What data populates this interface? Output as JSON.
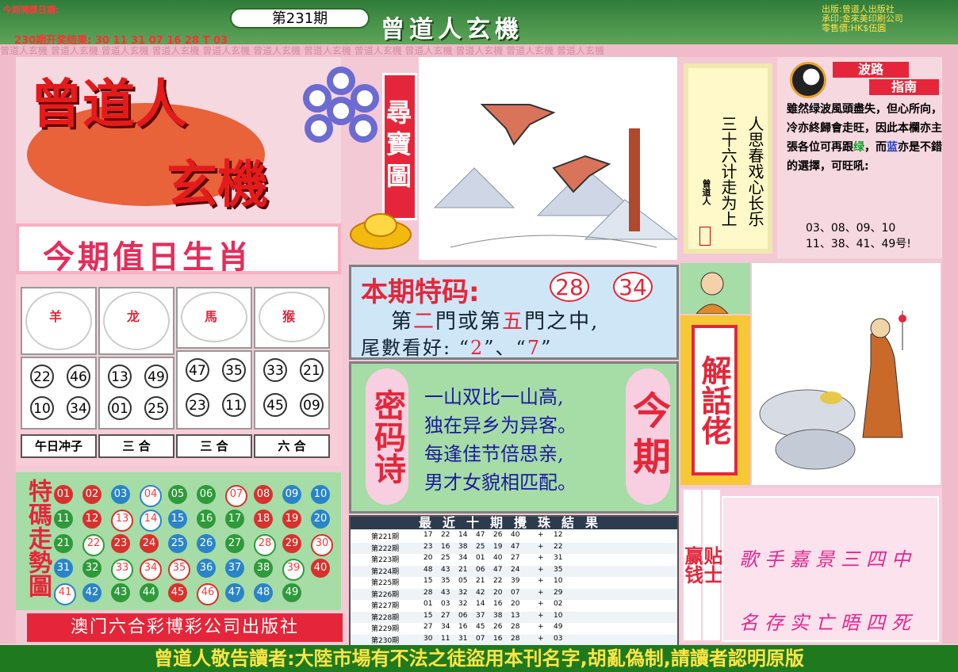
{
  "header": {
    "date_label": "今期開獎日期:",
    "issue": "第231期",
    "prev_result": "230期开奖结果: 30 11 31 07 16 28 T 03",
    "title": "曾道人玄機",
    "publisher": [
      "出版:曾道人出版社",
      "承印:金來美印刷公司",
      "零售價:HK$伍圓"
    ]
  },
  "strip_text": "曾道人玄機 曾道人玄機 曾道人玄機 曾道人玄機 曾道人玄機 曾道人玄機 曾道人玄機 曾道人玄機 曾道人玄機 曾道人玄機 曾道人玄機 曾道人玄機",
  "logo": {
    "line1": "曾道人",
    "line2": "玄機",
    "treasure": "尋寶圖"
  },
  "poem": {
    "line1": "人思春戏心长乐",
    "line2": "三十六计走为上",
    "signature": "曾道人"
  },
  "guide": {
    "title1": "波路",
    "title2": "指南",
    "p1": "雖然绿波風頭盡失，但心所向，冷亦終歸會走旺，因此本欄亦主張各位可再跟",
    "green": "绿",
    "and": "，而",
    "blue": "蓝",
    "p2": "亦是不錯的選擇，可旺吼:",
    "nums1": "03、08、09、10",
    "nums2": "11、38、41、49号!"
  },
  "zodiac": {
    "title": "今期值日生肖",
    "cards": [
      {
        "name": "羊",
        "balls": [
          "22",
          "46",
          "10",
          "34"
        ],
        "label": "午日冲子"
      },
      {
        "name": "龙",
        "balls": [
          "13",
          "49",
          "01",
          "25"
        ],
        "label": "三 合"
      },
      {
        "name": "馬",
        "balls": [
          "47",
          "35",
          "23",
          "11"
        ],
        "label": "三 合"
      },
      {
        "name": "猴",
        "balls": [
          "33",
          "21",
          "45",
          "09"
        ],
        "label": "六 合"
      }
    ]
  },
  "trend": {
    "title": "特碼走勢圖",
    "balls": [
      [
        "01",
        "02",
        "03",
        "04",
        "05",
        "06",
        "07",
        "08",
        "09",
        "10"
      ],
      [
        "11",
        "12",
        "13",
        "14",
        "15",
        "16",
        "17",
        "18",
        "19",
        "20"
      ],
      [
        "21",
        "22",
        "23",
        "24",
        "25",
        "26",
        "27",
        "28",
        "29",
        "30"
      ],
      [
        "31",
        "32",
        "33",
        "34",
        "35",
        "36",
        "37",
        "38",
        "39",
        "40"
      ],
      [
        "41",
        "42",
        "43",
        "44",
        "45",
        "46",
        "47",
        "48",
        "49"
      ]
    ],
    "colors": [
      [
        "r",
        "r",
        "b",
        "b",
        "g",
        "g",
        "r",
        "r",
        "b",
        "b"
      ],
      [
        "g",
        "r",
        "r",
        "b",
        "b",
        "g",
        "g",
        "r",
        "r",
        "b"
      ],
      [
        "g",
        "g",
        "r",
        "r",
        "b",
        "b",
        "g",
        "g",
        "r",
        "r"
      ],
      [
        "b",
        "g",
        "g",
        "r",
        "r",
        "b",
        "b",
        "g",
        "g",
        "r"
      ],
      [
        "b",
        "b",
        "g",
        "g",
        "r",
        "r",
        "b",
        "b",
        "g"
      ]
    ],
    "highlight": [
      "04",
      "07",
      "13",
      "14",
      "22",
      "28",
      "30",
      "33",
      "34",
      "35",
      "39",
      "41",
      "46"
    ]
  },
  "publisher_bar": "澳门六合彩博彩公司出版社",
  "special": {
    "label": "本期特码:",
    "num1": "28",
    "num2": "34",
    "line1_a": "第",
    "line1_b": "二",
    "line1_c": "門或第",
    "line1_d": "五",
    "line1_e": "門之中,",
    "line2_a": "尾數看好: “",
    "line2_b": "2",
    "line2_c": "”、“",
    "line2_d": "7",
    "line2_e": "”"
  },
  "code_poem": {
    "tag1": "密码诗",
    "tag2": "今期",
    "lines": [
      "一山双比一山高,",
      "独在异乡为异客。",
      "每逢佳节倍思亲,",
      "男才女貌相匹配。"
    ]
  },
  "results": {
    "title": "最近十期攪珠結果",
    "rows": [
      {
        "issue": "第221期",
        "nums": [
          "17",
          "22",
          "14",
          "47",
          "26",
          "40"
        ],
        "plus": "+",
        "sp": "12"
      },
      {
        "issue": "第222期",
        "nums": [
          "23",
          "16",
          "38",
          "25",
          "19",
          "47"
        ],
        "plus": "+",
        "sp": "22"
      },
      {
        "issue": "第223期",
        "nums": [
          "20",
          "25",
          "34",
          "01",
          "40",
          "27"
        ],
        "plus": "+",
        "sp": "31"
      },
      {
        "issue": "第224期",
        "nums": [
          "48",
          "43",
          "21",
          "06",
          "47",
          "24"
        ],
        "plus": "+",
        "sp": "35"
      },
      {
        "issue": "第225期",
        "nums": [
          "15",
          "35",
          "05",
          "21",
          "22",
          "39"
        ],
        "plus": "+",
        "sp": "10"
      },
      {
        "issue": "第226期",
        "nums": [
          "28",
          "43",
          "32",
          "42",
          "20",
          "07"
        ],
        "plus": "+",
        "sp": "29"
      },
      {
        "issue": "第227期",
        "nums": [
          "01",
          "03",
          "32",
          "14",
          "16",
          "20"
        ],
        "plus": "+",
        "sp": "02"
      },
      {
        "issue": "第228期",
        "nums": [
          "15",
          "27",
          "06",
          "37",
          "38",
          "13"
        ],
        "plus": "+",
        "sp": "10"
      },
      {
        "issue": "第229期",
        "nums": [
          "27",
          "34",
          "16",
          "45",
          "26",
          "28"
        ],
        "plus": "+",
        "sp": "49"
      },
      {
        "issue": "第230期",
        "nums": [
          "30",
          "11",
          "31",
          "07",
          "16",
          "28"
        ],
        "plus": "+",
        "sp": "03"
      }
    ]
  },
  "talk": {
    "title": "解話佬"
  },
  "win": {
    "label1": "赢钱",
    "label2": "贴士",
    "line1": "歌手嘉景三四中",
    "line2": "名存实亡晤四死"
  },
  "footer": "曾道人敬告讀者:大陸市場有不法之徒盜用本刊名字,胡亂偽制,請讀者認明原版",
  "colors": {
    "red": "#e5263a",
    "green": "#1f7a1f",
    "pink": "#f3c9d6",
    "ball_red": "#d9312c",
    "ball_blue": "#2a84c9",
    "ball_green": "#2e9a3a"
  }
}
